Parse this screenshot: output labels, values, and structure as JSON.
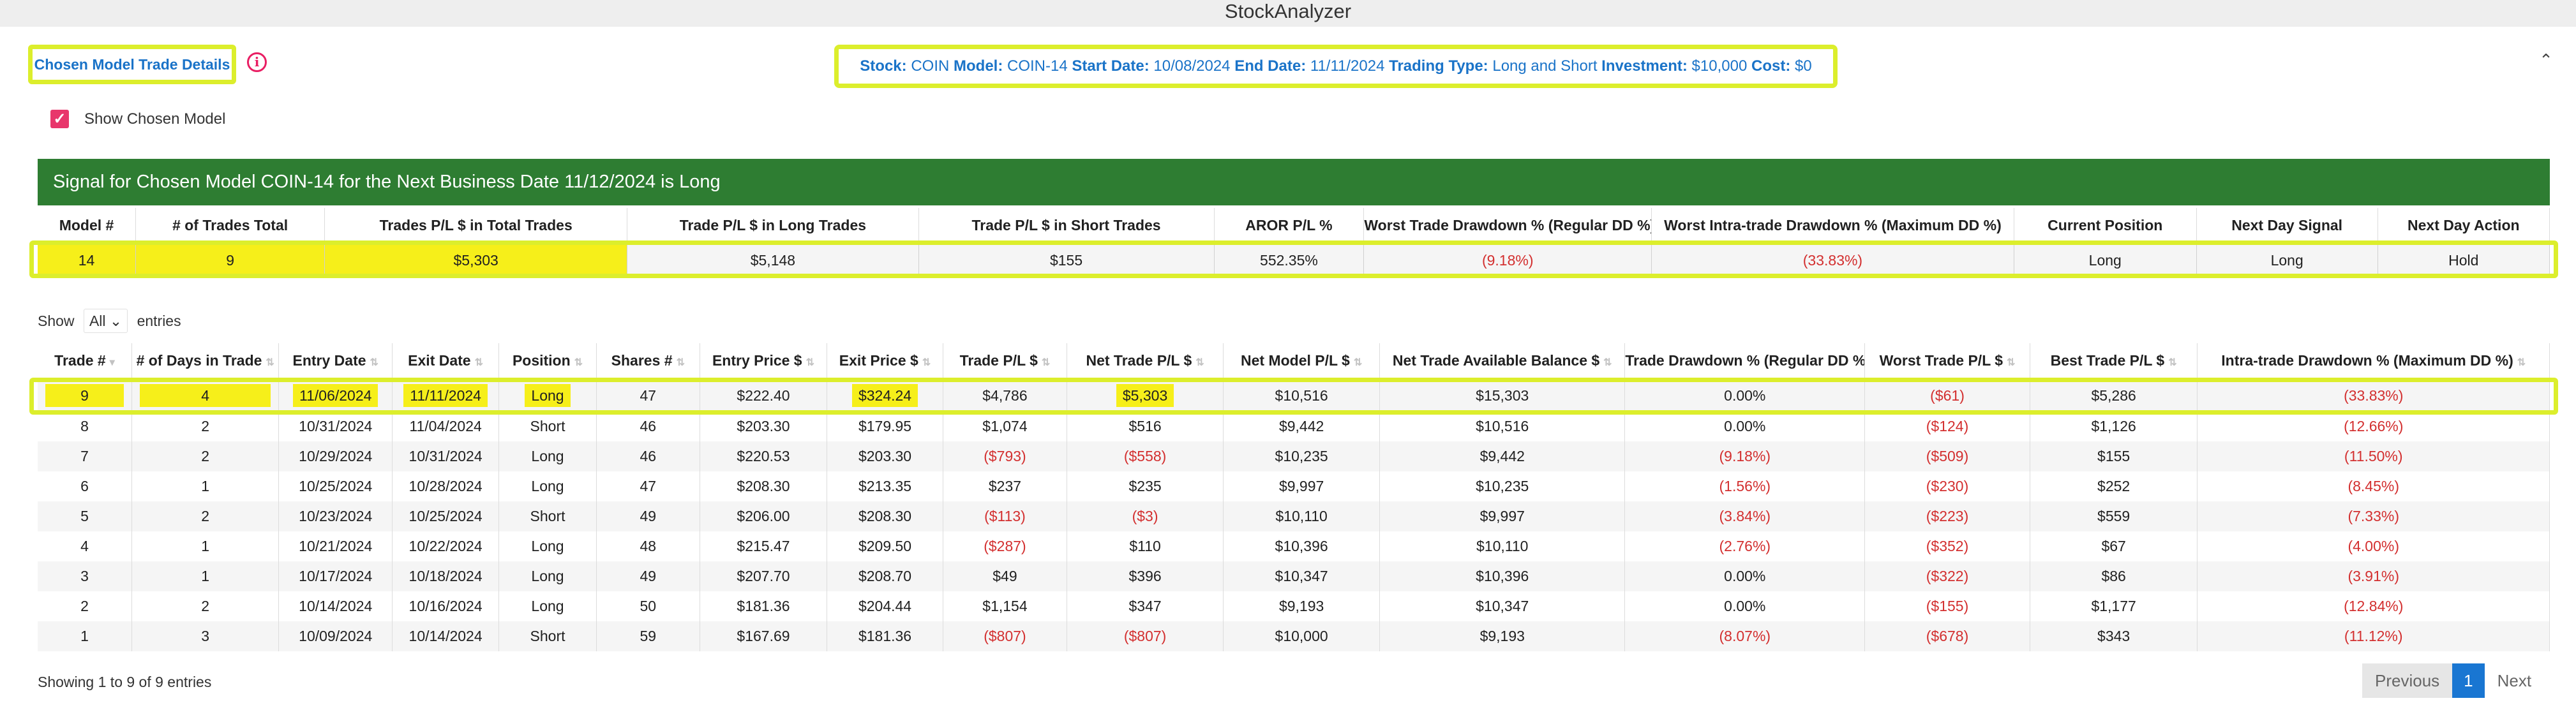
{
  "app": {
    "title": "StockAnalyzer"
  },
  "header": {
    "model_button_label": "Chosen Model Trade Details",
    "summary": {
      "stock_key": "Stock:",
      "stock": "COIN",
      "model_key": "Model:",
      "model": "COIN-14",
      "start_key": "Start Date:",
      "start": "10/08/2024",
      "end_key": "End Date:",
      "end": "11/11/2024",
      "type_key": "Trading Type:",
      "type": "Long and Short",
      "investment_key": "Investment:",
      "investment": "$10,000",
      "cost_key": "Cost:",
      "cost": "$0"
    },
    "show_chosen_label": "Show Chosen Model",
    "info_icon": "info-icon",
    "collapse_icon": "chevron-up-icon"
  },
  "signal": {
    "text": "Signal for Chosen Model COIN-14 for the Next Business Date 11/12/2024 is Long"
  },
  "model_table": {
    "headers": [
      "Model #",
      "# of Trades Total",
      "Trades P/L $ in Total Trades",
      "Trade P/L $ in Long Trades",
      "Trade P/L $ in Short Trades",
      "AROR P/L %",
      "Worst Trade Drawdown % (Regular DD %)",
      "Worst Intra-trade Drawdown % (Maximum DD %)",
      "Current Position",
      "Next Day Signal",
      "Next Day Action"
    ],
    "row": [
      "14",
      "9",
      "$5,303",
      "$5,148",
      "$155",
      "552.35%",
      "(9.18%)",
      "(33.83%)",
      "Long",
      "Long",
      "Hold"
    ]
  },
  "entries": {
    "show_label": "Show",
    "selected": "All",
    "entries_label": "entries"
  },
  "trades_table": {
    "headers": [
      "Trade #",
      "# of Days in Trade",
      "Entry Date",
      "Exit Date",
      "Position",
      "Shares #",
      "Entry Price $",
      "Exit Price $",
      "Trade P/L $",
      "Net Trade P/L $",
      "Net Model P/L $",
      "Net Trade Available Balance $",
      "Trade Drawdown % (Regular DD %)",
      "Worst Trade P/L $",
      "Best Trade P/L $",
      "Intra-trade Drawdown % (Maximum DD %)"
    ],
    "rows": [
      [
        "9",
        "4",
        "11/06/2024",
        "11/11/2024",
        "Long",
        "47",
        "$222.40",
        "$324.24",
        "$4,786",
        "$5,303",
        "$10,516",
        "$15,303",
        "0.00%",
        "($61)",
        "$5,286",
        "(33.83%)"
      ],
      [
        "8",
        "2",
        "10/31/2024",
        "11/04/2024",
        "Short",
        "46",
        "$203.30",
        "$179.95",
        "$1,074",
        "$516",
        "$9,442",
        "$10,516",
        "0.00%",
        "($124)",
        "$1,126",
        "(12.66%)"
      ],
      [
        "7",
        "2",
        "10/29/2024",
        "10/31/2024",
        "Long",
        "46",
        "$220.53",
        "$203.30",
        "($793)",
        "($558)",
        "$10,235",
        "$9,442",
        "(9.18%)",
        "($509)",
        "$155",
        "(11.50%)"
      ],
      [
        "6",
        "1",
        "10/25/2024",
        "10/28/2024",
        "Long",
        "47",
        "$208.30",
        "$213.35",
        "$237",
        "$235",
        "$9,997",
        "$10,235",
        "(1.56%)",
        "($230)",
        "$252",
        "(8.45%)"
      ],
      [
        "5",
        "2",
        "10/23/2024",
        "10/25/2024",
        "Short",
        "49",
        "$206.00",
        "$208.30",
        "($113)",
        "($3)",
        "$10,110",
        "$9,997",
        "(3.84%)",
        "($223)",
        "$559",
        "(7.33%)"
      ],
      [
        "4",
        "1",
        "10/21/2024",
        "10/22/2024",
        "Long",
        "48",
        "$215.47",
        "$209.50",
        "($287)",
        "$110",
        "$10,396",
        "$10,110",
        "(2.76%)",
        "($352)",
        "$67",
        "(4.00%)"
      ],
      [
        "3",
        "1",
        "10/17/2024",
        "10/18/2024",
        "Long",
        "49",
        "$207.70",
        "$208.70",
        "$49",
        "$396",
        "$10,347",
        "$10,396",
        "0.00%",
        "($322)",
        "$86",
        "(3.91%)"
      ],
      [
        "2",
        "2",
        "10/14/2024",
        "10/16/2024",
        "Long",
        "50",
        "$181.36",
        "$204.44",
        "$1,154",
        "$347",
        "$9,193",
        "$10,347",
        "0.00%",
        "($155)",
        "$1,177",
        "(12.84%)"
      ],
      [
        "1",
        "3",
        "10/09/2024",
        "10/14/2024",
        "Short",
        "59",
        "$167.69",
        "$181.36",
        "($807)",
        "($807)",
        "$10,000",
        "$9,193",
        "(8.07%)",
        "($678)",
        "$343",
        "(11.12%)"
      ]
    ]
  },
  "footer": {
    "info": "Showing 1 to 9 of 9 entries",
    "previous": "Previous",
    "page": "1",
    "next": "Next"
  },
  "colors": {
    "highlight": "#f6ef1a",
    "frame": "#dcee2c",
    "signal_bg": "#2e7d32",
    "negative": "#d32f2f",
    "link": "#1a73c8",
    "checkbox": "#e8366b"
  }
}
